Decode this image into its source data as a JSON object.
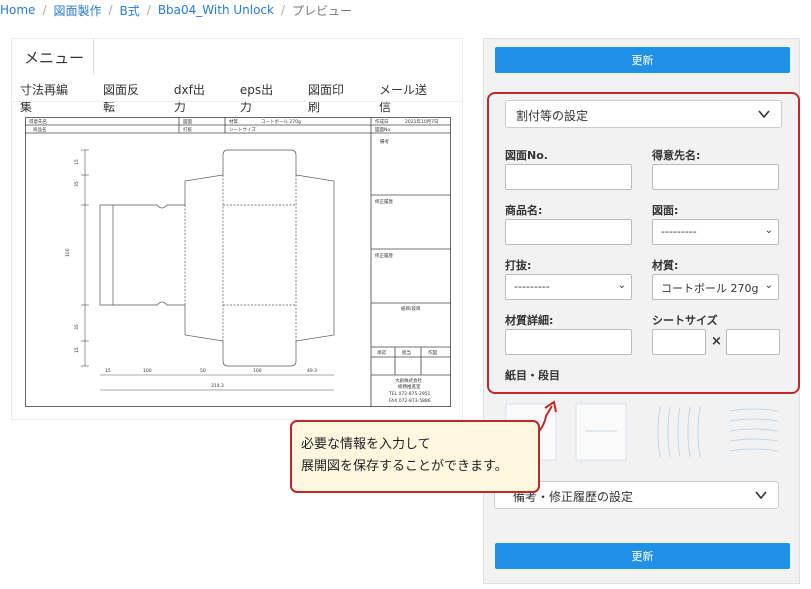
{
  "breadcrumb": {
    "home": "Home",
    "item1": "図面製作",
    "item2": "B式",
    "item3": "Bba04_With Unlock",
    "current": "プレビュー"
  },
  "menu": {
    "title": "メニュー",
    "items": [
      "寸法再編集",
      "図面反転",
      "dxf出力",
      "eps出力",
      "図面印刷",
      "メール送信"
    ]
  },
  "drawing": {
    "row1": [
      "得意先名",
      "図面",
      "材質",
      "コートボール 270g",
      "作成日",
      "2021年10月7日"
    ],
    "row2": [
      "商品名",
      "打抜",
      "シートサイズ",
      "図面No."
    ],
    "notes": "備考",
    "rev1": "修正履歴",
    "rev2": "修正履歴",
    "grain": "紙目/段目",
    "approvals": [
      "承認",
      "担当",
      "作図"
    ],
    "company": [
      "大創株式会社",
      "総務推進室",
      "TEL 072-875-2951",
      "FAX 072-873-5886"
    ],
    "dims_bottom": [
      "15",
      "100",
      "50",
      "100",
      "49.3"
    ],
    "dim_total": "314.3",
    "dims_left": [
      "15",
      "35",
      "100",
      "35",
      "15"
    ]
  },
  "right": {
    "update_label": "更新",
    "section1": "割付等の設定",
    "fields": {
      "zumen_no": "図面No.",
      "tokuisaki": "得意先名:",
      "shohin": "商品名:",
      "zumen": "図面:",
      "zumen_value": "---------",
      "uchinuki": "打抜:",
      "uchinuki_value": "---------",
      "zaishitsu": "材質:",
      "zaishitsu_value": "コートボール 270g",
      "zaishitsu_detail": "材質詳細:",
      "sheet_size": "シートサイズ",
      "times": "×",
      "grain": "紙目・段目"
    },
    "section2": "備考・修正履歴の設定"
  },
  "callout": {
    "line1": "必要な情報を入力して",
    "line2": "展開図を保存することができます。"
  },
  "colors": {
    "accent": "#1e90e8",
    "highlight": "#c0282a",
    "callout_bg": "#fdf7df"
  },
  "icons": {
    "chevron": "chevron-down-icon",
    "select_arrow": "select-arrow-icon"
  }
}
